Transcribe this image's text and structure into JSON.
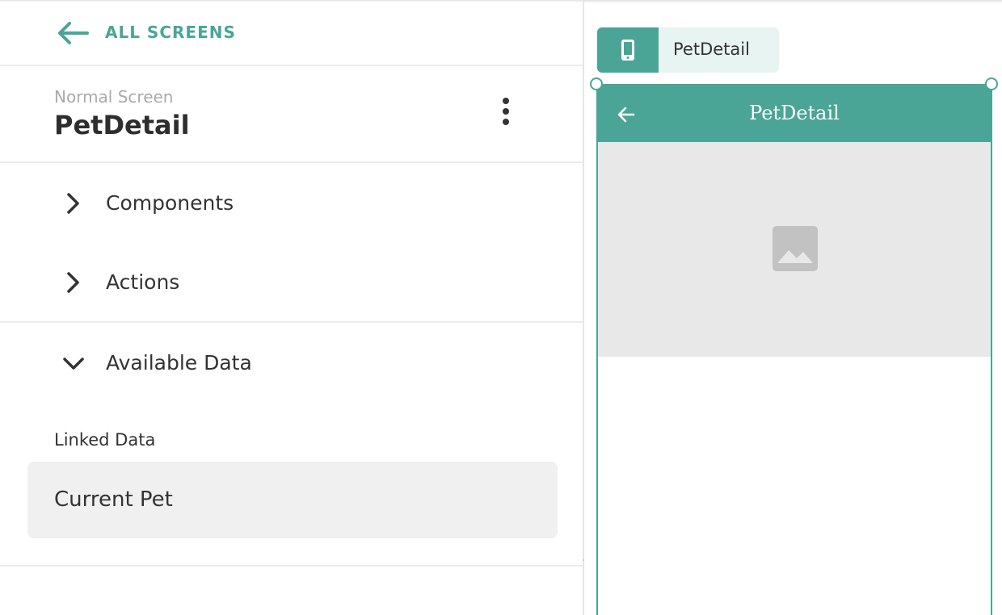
{
  "sidebar": {
    "back_label": "ALL SCREENS",
    "screen_type": "Normal Screen",
    "screen_name": "PetDetail",
    "sections": [
      {
        "label": "Components",
        "expanded": false
      },
      {
        "label": "Actions",
        "expanded": false
      },
      {
        "label": "Available Data",
        "expanded": true
      }
    ],
    "linked_data_label": "Linked Data",
    "linked_items": [
      {
        "label": "Current Pet"
      }
    ]
  },
  "canvas": {
    "screen_tag": "PetDetail",
    "preview": {
      "title": "PetDetail"
    }
  },
  "colors": {
    "accent": "#4aa597",
    "hero_bg": "#e8e8e8",
    "item_bg": "#f0f0f0"
  },
  "icons": [
    "back-arrow-icon",
    "more-vertical-icon",
    "chevron-right-icon",
    "chevron-down-icon",
    "phone-icon",
    "image-placeholder-icon"
  ]
}
